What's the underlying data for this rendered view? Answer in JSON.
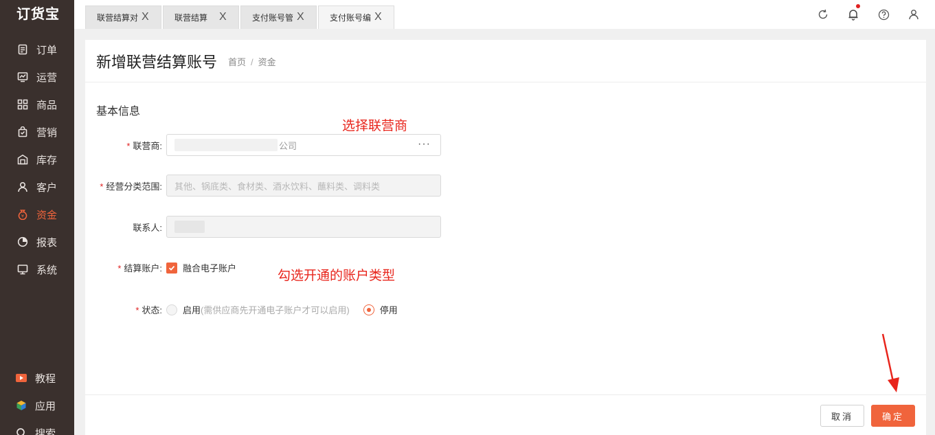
{
  "app": {
    "logo": "订货宝"
  },
  "sidebar": {
    "items": [
      {
        "label": "订单",
        "icon": "order-icon"
      },
      {
        "label": "运营",
        "icon": "chart-board-icon"
      },
      {
        "label": "商品",
        "icon": "grid-icon"
      },
      {
        "label": "营销",
        "icon": "bag-icon"
      },
      {
        "label": "库存",
        "icon": "warehouse-icon"
      },
      {
        "label": "客户",
        "icon": "user-icon"
      },
      {
        "label": "资金",
        "icon": "money-bag-icon",
        "active": true
      },
      {
        "label": "报表",
        "icon": "pie-chart-icon"
      },
      {
        "label": "系统",
        "icon": "monitor-icon"
      }
    ],
    "bottom": [
      {
        "label": "教程",
        "icon": "video-icon"
      },
      {
        "label": "应用",
        "icon": "cube-icon"
      },
      {
        "label": "搜索",
        "icon": "search-icon"
      }
    ]
  },
  "tabs": [
    {
      "label": "联营结算对",
      "close": "X"
    },
    {
      "label": "联营结算",
      "close": "X"
    },
    {
      "label": "支付账号管",
      "close": "X"
    },
    {
      "label": "支付账号编",
      "close": "X",
      "active": true
    }
  ],
  "page": {
    "title": "新增联营结算账号",
    "breadcrumb": [
      "首页",
      "资金"
    ],
    "breadcrumb_sep": "/",
    "section_title": "基本信息"
  },
  "form": {
    "required_mark": "*",
    "supplier": {
      "label": "联营商:",
      "value_end": "公司",
      "more": "···"
    },
    "scope": {
      "label": "经营分类范围:",
      "value": "其他、锅底类、食材类、酒水饮料、蘸料类、调料类"
    },
    "contact": {
      "label": "联系人:"
    },
    "account": {
      "label": "结算账户:",
      "option": "融合电子账户",
      "checked": true
    },
    "status": {
      "label": "状态:",
      "option_enable": "启用",
      "enable_hint": "(需供应商先开通电子账户才可以启用)",
      "option_disable": "停用",
      "selected": "停用"
    }
  },
  "annotations": {
    "select_supplier": "选择联营商",
    "check_account": "勾选开通的账户类型"
  },
  "footer": {
    "cancel": "取消",
    "confirm": "确定"
  },
  "colors": {
    "accent": "#f0643c",
    "sidebar_bg": "#3a302d",
    "annotation": "#e8251c"
  }
}
